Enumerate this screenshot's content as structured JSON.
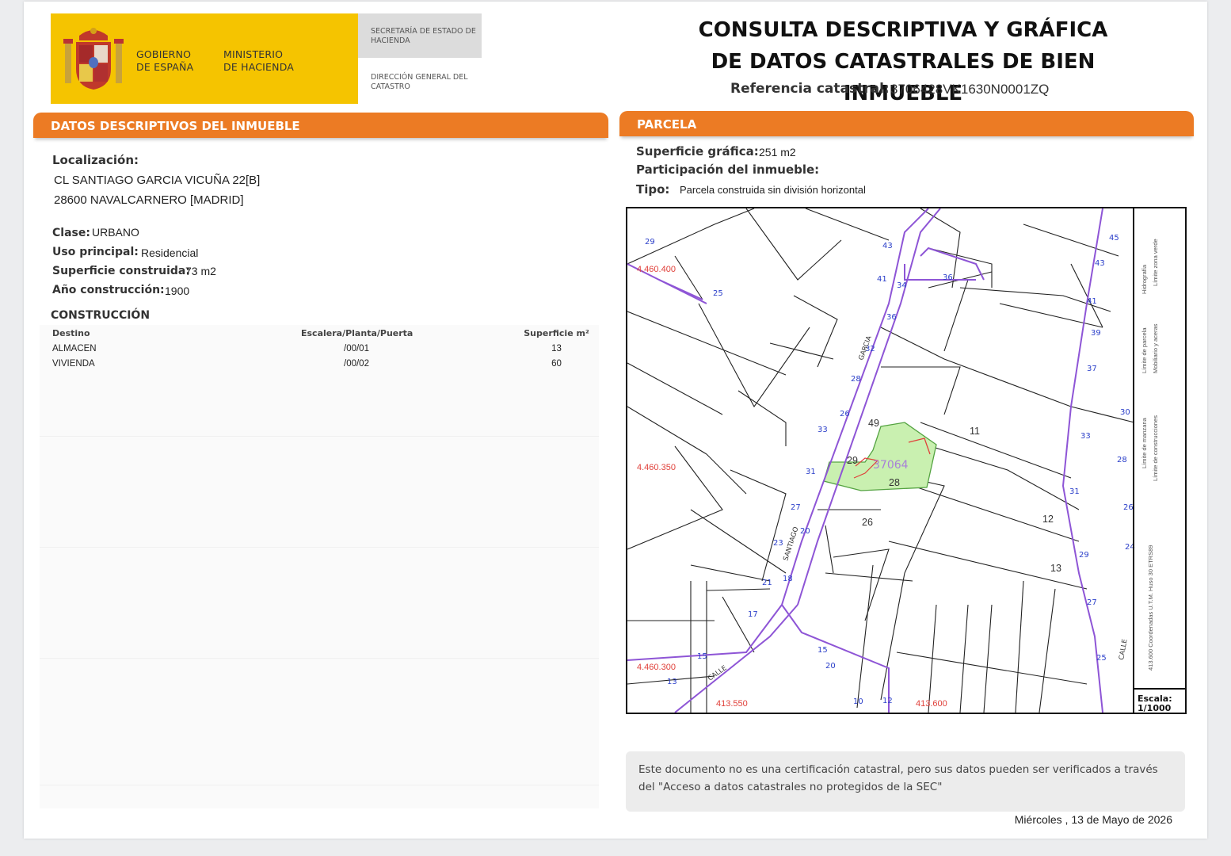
{
  "header": {
    "gov_line1": "Gobierno",
    "gov_line2": "de España",
    "ministry_line1": "Ministerio",
    "ministry_line2": "de Hacienda",
    "secretaria": "Secretaría de Estado de Hacienda",
    "direccion": "Dirección General del Catastro",
    "title_line1": "CONSULTA DESCRIPTIVA Y GRÁFICA",
    "title_line2": "DE DATOS CATASTRALES DE BIEN INMUEBLE",
    "refcat_label": "Referencia catastral:",
    "refcat_value": "3706428VK1630N0001ZQ"
  },
  "descriptivos": {
    "section_title": "DATOS DESCRIPTIVOS DEL INMUEBLE",
    "localizacion_label": "Localización:",
    "address_line1": "CL SANTIAGO GARCIA VICUÑA 22[B]",
    "address_line2": "28600 NAVALCARNERO [MADRID]",
    "clase_label": "Clase:",
    "clase_value": "URBANO",
    "uso_label": "Uso principal:",
    "uso_value": "Residencial",
    "superficie_label": "Superficie construida:",
    "superficie_value": "73 m2",
    "anio_label": "Año construcción:",
    "anio_value": "1900"
  },
  "construccion": {
    "title": "CONSTRUCCIÓN",
    "headers": [
      "Destino",
      "Escalera/Planta/Puerta",
      "Superficie m²"
    ],
    "rows": [
      [
        "ALMACEN",
        "/00/01",
        "13"
      ],
      [
        "VIVIENDA",
        "/00/02",
        "60"
      ]
    ]
  },
  "parcela": {
    "section_title": "PARCELA",
    "superficie_label": "Superficie gráfica:",
    "superficie_value": "251 m2",
    "participacion_label": "Participación del inmueble:",
    "tipo_label": "Tipo:",
    "tipo_value": "Parcela construida sin división horizontal"
  },
  "map": {
    "coord_labels": [
      "4.460.400",
      "4.460.350",
      "4.460.300",
      "413.550",
      "413.600"
    ],
    "parcel_numbers": [
      "49",
      "11",
      "29",
      "28",
      "12",
      "26",
      "13"
    ],
    "highlight_label": "37064",
    "street_labels": [
      "SANTIAGO",
      "GARCIA",
      "CALLE",
      "CALLE"
    ],
    "scale_label": "Escala:",
    "scale_value": "1/1000",
    "legend_items": [
      "Límite de manzana",
      "Límite de parcela",
      "Hidrografía",
      "Límite de construcciones",
      "Mobiliario y aceras",
      "Límite zona verde"
    ],
    "legend_footer": "413.600 Coordenadas U.T.M. Huso 30 ETRS89",
    "colors": {
      "blocks": "#8e55d6",
      "highlight": "#c9f0b0",
      "coords": "#e0403a",
      "numbers_blue": "#2a3ec9"
    }
  },
  "footer": {
    "notice": "Este documento no es una certificación catastral, pero sus datos pueden ser verificados a través del \"Acceso a datos catastrales no protegidos de la SEC\"",
    "date": "Miércoles , 13 de Mayo de 2026"
  }
}
